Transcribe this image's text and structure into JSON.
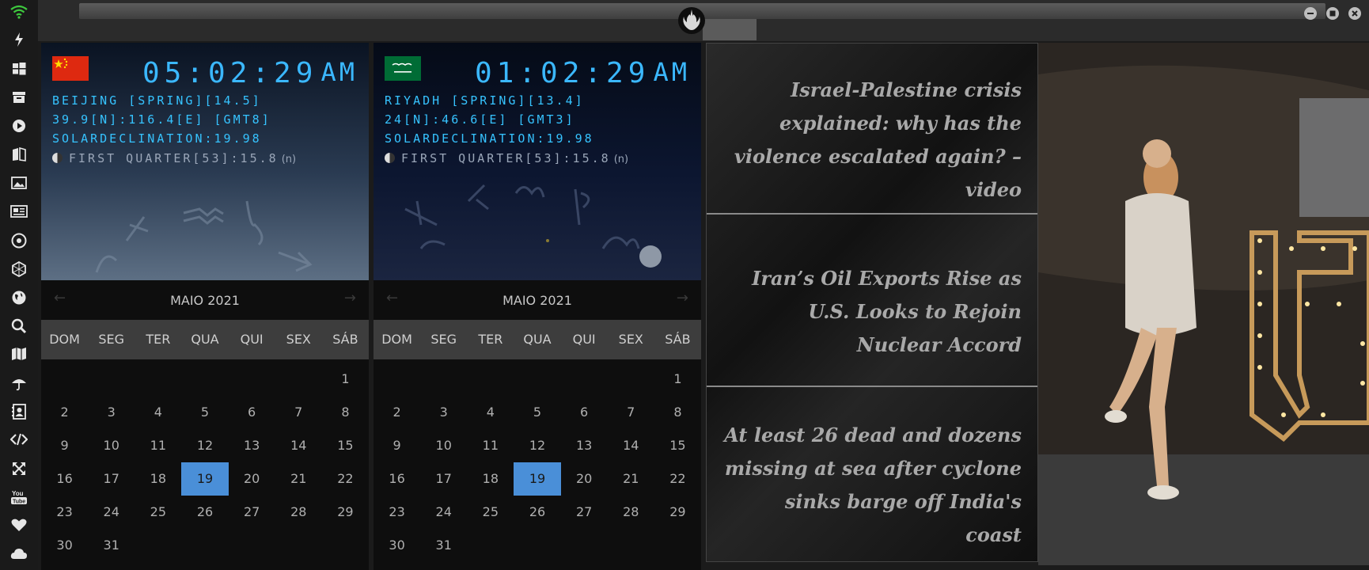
{
  "sidebar": {
    "icons": [
      "wifi-icon",
      "lightning-icon",
      "windows-icon",
      "archive-icon",
      "play-icon",
      "book-icon",
      "image-icon",
      "news-icon",
      "aperture-icon",
      "hexagon-icon",
      "globe-icon",
      "search-icon",
      "map-icon",
      "umbrella-icon",
      "contact-icon",
      "code-icon",
      "expand-icon",
      "youtube-icon",
      "heart-icon",
      "cloud-icon"
    ]
  },
  "clocks": [
    {
      "time": "05:02:29",
      "ampm": "AM",
      "line1": "BEIJING [SPRING][14.5]",
      "line2": "39.9[N]:116.4[E] [GMT8]",
      "line3": "SOLARDECLINATION:19.98",
      "moon": "FIRST QUARTER[53]:15.8",
      "moon_suffix": "(n)",
      "flag": "china-flag"
    },
    {
      "time": "01:02:29",
      "ampm": "AM",
      "line1": "RIYADH [SPRING][13.4]",
      "line2": "24[N]:46.6[E] [GMT3]",
      "line3": "SOLARDECLINATION:19.98",
      "moon": "FIRST QUARTER[53]:15.8",
      "moon_suffix": "(n)",
      "flag": "saudi-flag"
    }
  ],
  "calendar": {
    "month": "MAIO 2021",
    "weekdays": [
      "DOM",
      "SEG",
      "TER",
      "QUA",
      "QUI",
      "SEX",
      "SÁB"
    ],
    "today": "19",
    "days": [
      "",
      "",
      "",
      "",
      "",
      "",
      "1",
      "2",
      "3",
      "4",
      "5",
      "6",
      "7",
      "8",
      "9",
      "10",
      "11",
      "12",
      "13",
      "14",
      "15",
      "16",
      "17",
      "18",
      "19",
      "20",
      "21",
      "22",
      "23",
      "24",
      "25",
      "26",
      "27",
      "28",
      "29",
      "30",
      "31"
    ]
  },
  "news": [
    "Israel-Palestine crisis explained: why has the violence escalated again? – video",
    "Iran’s Oil Exports Rise as U.S. Looks to Rejoin Nuclear Accord",
    "At least 26 dead and dozens missing at sea after cyclone sinks barge off India's coast"
  ],
  "window": {
    "buttons": [
      "minimize-button",
      "maximize-button",
      "close-button"
    ]
  },
  "colors": {
    "accent": "#3bb8ff",
    "today": "#4a8fd8"
  }
}
